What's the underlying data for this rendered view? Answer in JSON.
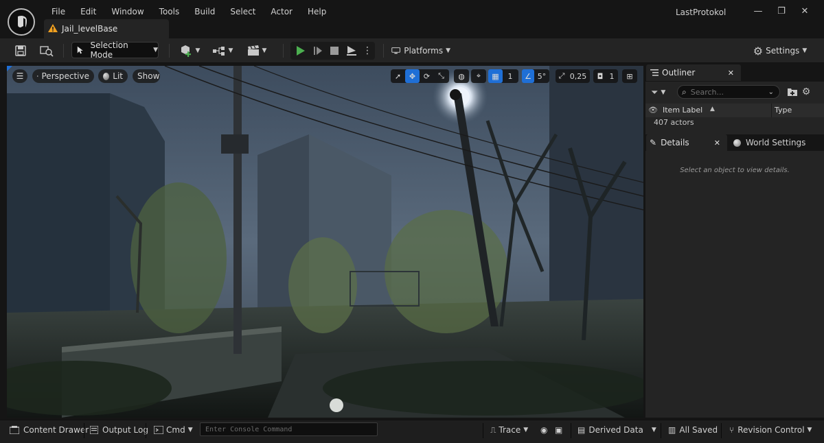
{
  "menu": {
    "items": [
      "File",
      "Edit",
      "Window",
      "Tools",
      "Build",
      "Select",
      "Actor",
      "Help"
    ]
  },
  "document_tab": {
    "label": "Jail_levelBase"
  },
  "app": {
    "title": "LastProtokol"
  },
  "window_controls": {
    "minimize": "—",
    "restore": "❐",
    "close": "✕"
  },
  "toolbar": {
    "mode_label": "Selection Mode",
    "platforms_label": "Platforms",
    "settings_label": "Settings"
  },
  "viewport": {
    "view_label": "Perspective",
    "lit_label": "Lit",
    "show_label": "Show",
    "grid_snap_value": "1",
    "rotation_snap_value": "5°",
    "scale_snap_value": "0,25",
    "camera_speed_value": "1"
  },
  "outliner": {
    "tab_label": "Outliner",
    "search_placeholder": "Search...",
    "col_item_label": "Item Label",
    "col_type": "Type",
    "actor_count": "407 actors"
  },
  "details": {
    "tab_label": "Details",
    "world_settings_label": "World Settings",
    "empty_message": "Select an object to view details."
  },
  "statusbar": {
    "content_drawer": "Content Drawer",
    "output_log": "Output Log",
    "cmd_label": "Cmd",
    "console_placeholder": "Enter Console Command",
    "trace_label": "Trace",
    "derived_data_label": "Derived Data",
    "all_saved_label": "All Saved",
    "revision_control_label": "Revision Control"
  },
  "colors": {
    "play_green": "#4caf50",
    "select_blue": "#1f6fd6",
    "panel_bg": "#242424",
    "title_bg": "#151515"
  }
}
